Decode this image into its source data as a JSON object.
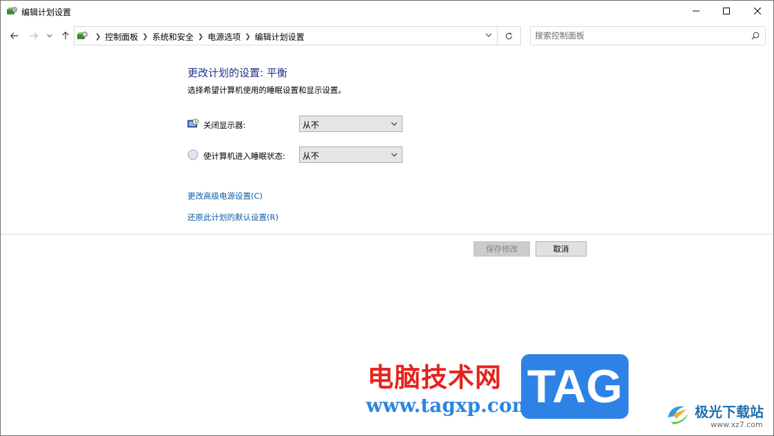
{
  "window": {
    "title": "编辑计划设置"
  },
  "title_controls": {
    "minimize": "minimize",
    "maximize": "maximize",
    "close": "close"
  },
  "breadcrumb": [
    "控制面板",
    "系统和安全",
    "电源选项",
    "编辑计划设置"
  ],
  "search": {
    "placeholder": "搜索控制面板",
    "value": ""
  },
  "main": {
    "heading": "更改计划的设置: 平衡",
    "subtext": "选择希望计算机使用的睡眠设置和显示设置。",
    "display_off": {
      "label": "关闭显示器:",
      "value": "从不"
    },
    "sleep": {
      "label": "使计算机进入睡眠状态:",
      "value": "从不"
    },
    "link_advanced": "更改高级电源设置(C)",
    "link_restore": "还原此计划的默认设置(R)",
    "save_label": "保存修改",
    "cancel_label": "取消"
  },
  "watermark": {
    "site_cn": "电脑技术网",
    "url": "www.tagxp.com",
    "tag": "TAG",
    "xz7": "极光下载站",
    "xz7_url": "www.xz7.com"
  },
  "colors": {
    "heading": "#1e3287",
    "link": "#0c5ea6",
    "watermark_red": "#e5231e",
    "watermark_blue": "#2f82e5"
  }
}
